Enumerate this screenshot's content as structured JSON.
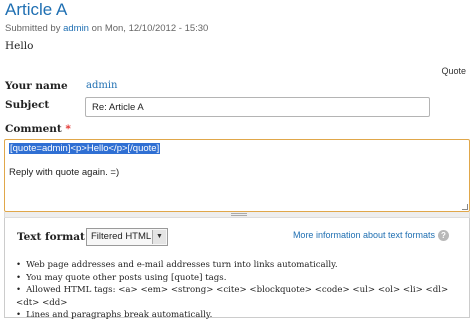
{
  "article": {
    "title": "Article A",
    "submitted_prefix": "Submitted by",
    "author": "admin",
    "submitted_suffix": "on Mon, 12/10/2012 - 15:30",
    "body": "Hello"
  },
  "links": {
    "quote": "Quote"
  },
  "form": {
    "name_label": "Your name",
    "name_value": "admin",
    "subject_label": "Subject",
    "subject_value": "Re: Article A",
    "comment_label": "Comment",
    "required_marker": "*",
    "comment_selected": "[quote=admin]<p>Hello</p>[/quote]",
    "comment_line2": "Reply with quote again. =)"
  },
  "text_format": {
    "label": "Text format",
    "selected": "Filtered HTML",
    "more_info": "More information about text formats",
    "help_glyph": "?",
    "tips": [
      "Web page addresses and e-mail addresses turn into links automatically.",
      "You may quote other posts using [quote] tags.",
      "Allowed HTML tags: <a> <em> <strong> <cite> <blockquote> <code> <ul> <ol> <li> <dl> <dt> <dd>",
      "Lines and paragraphs break automatically."
    ]
  },
  "colors": {
    "link": "#1f6fb2",
    "focus_border": "#e0a74a",
    "selection": "#2f6fd3",
    "required": "#e0231f"
  },
  "icons": {
    "help": "help-icon",
    "dropdown": "chevron-down-icon",
    "resize": "resize-handle-icon"
  }
}
